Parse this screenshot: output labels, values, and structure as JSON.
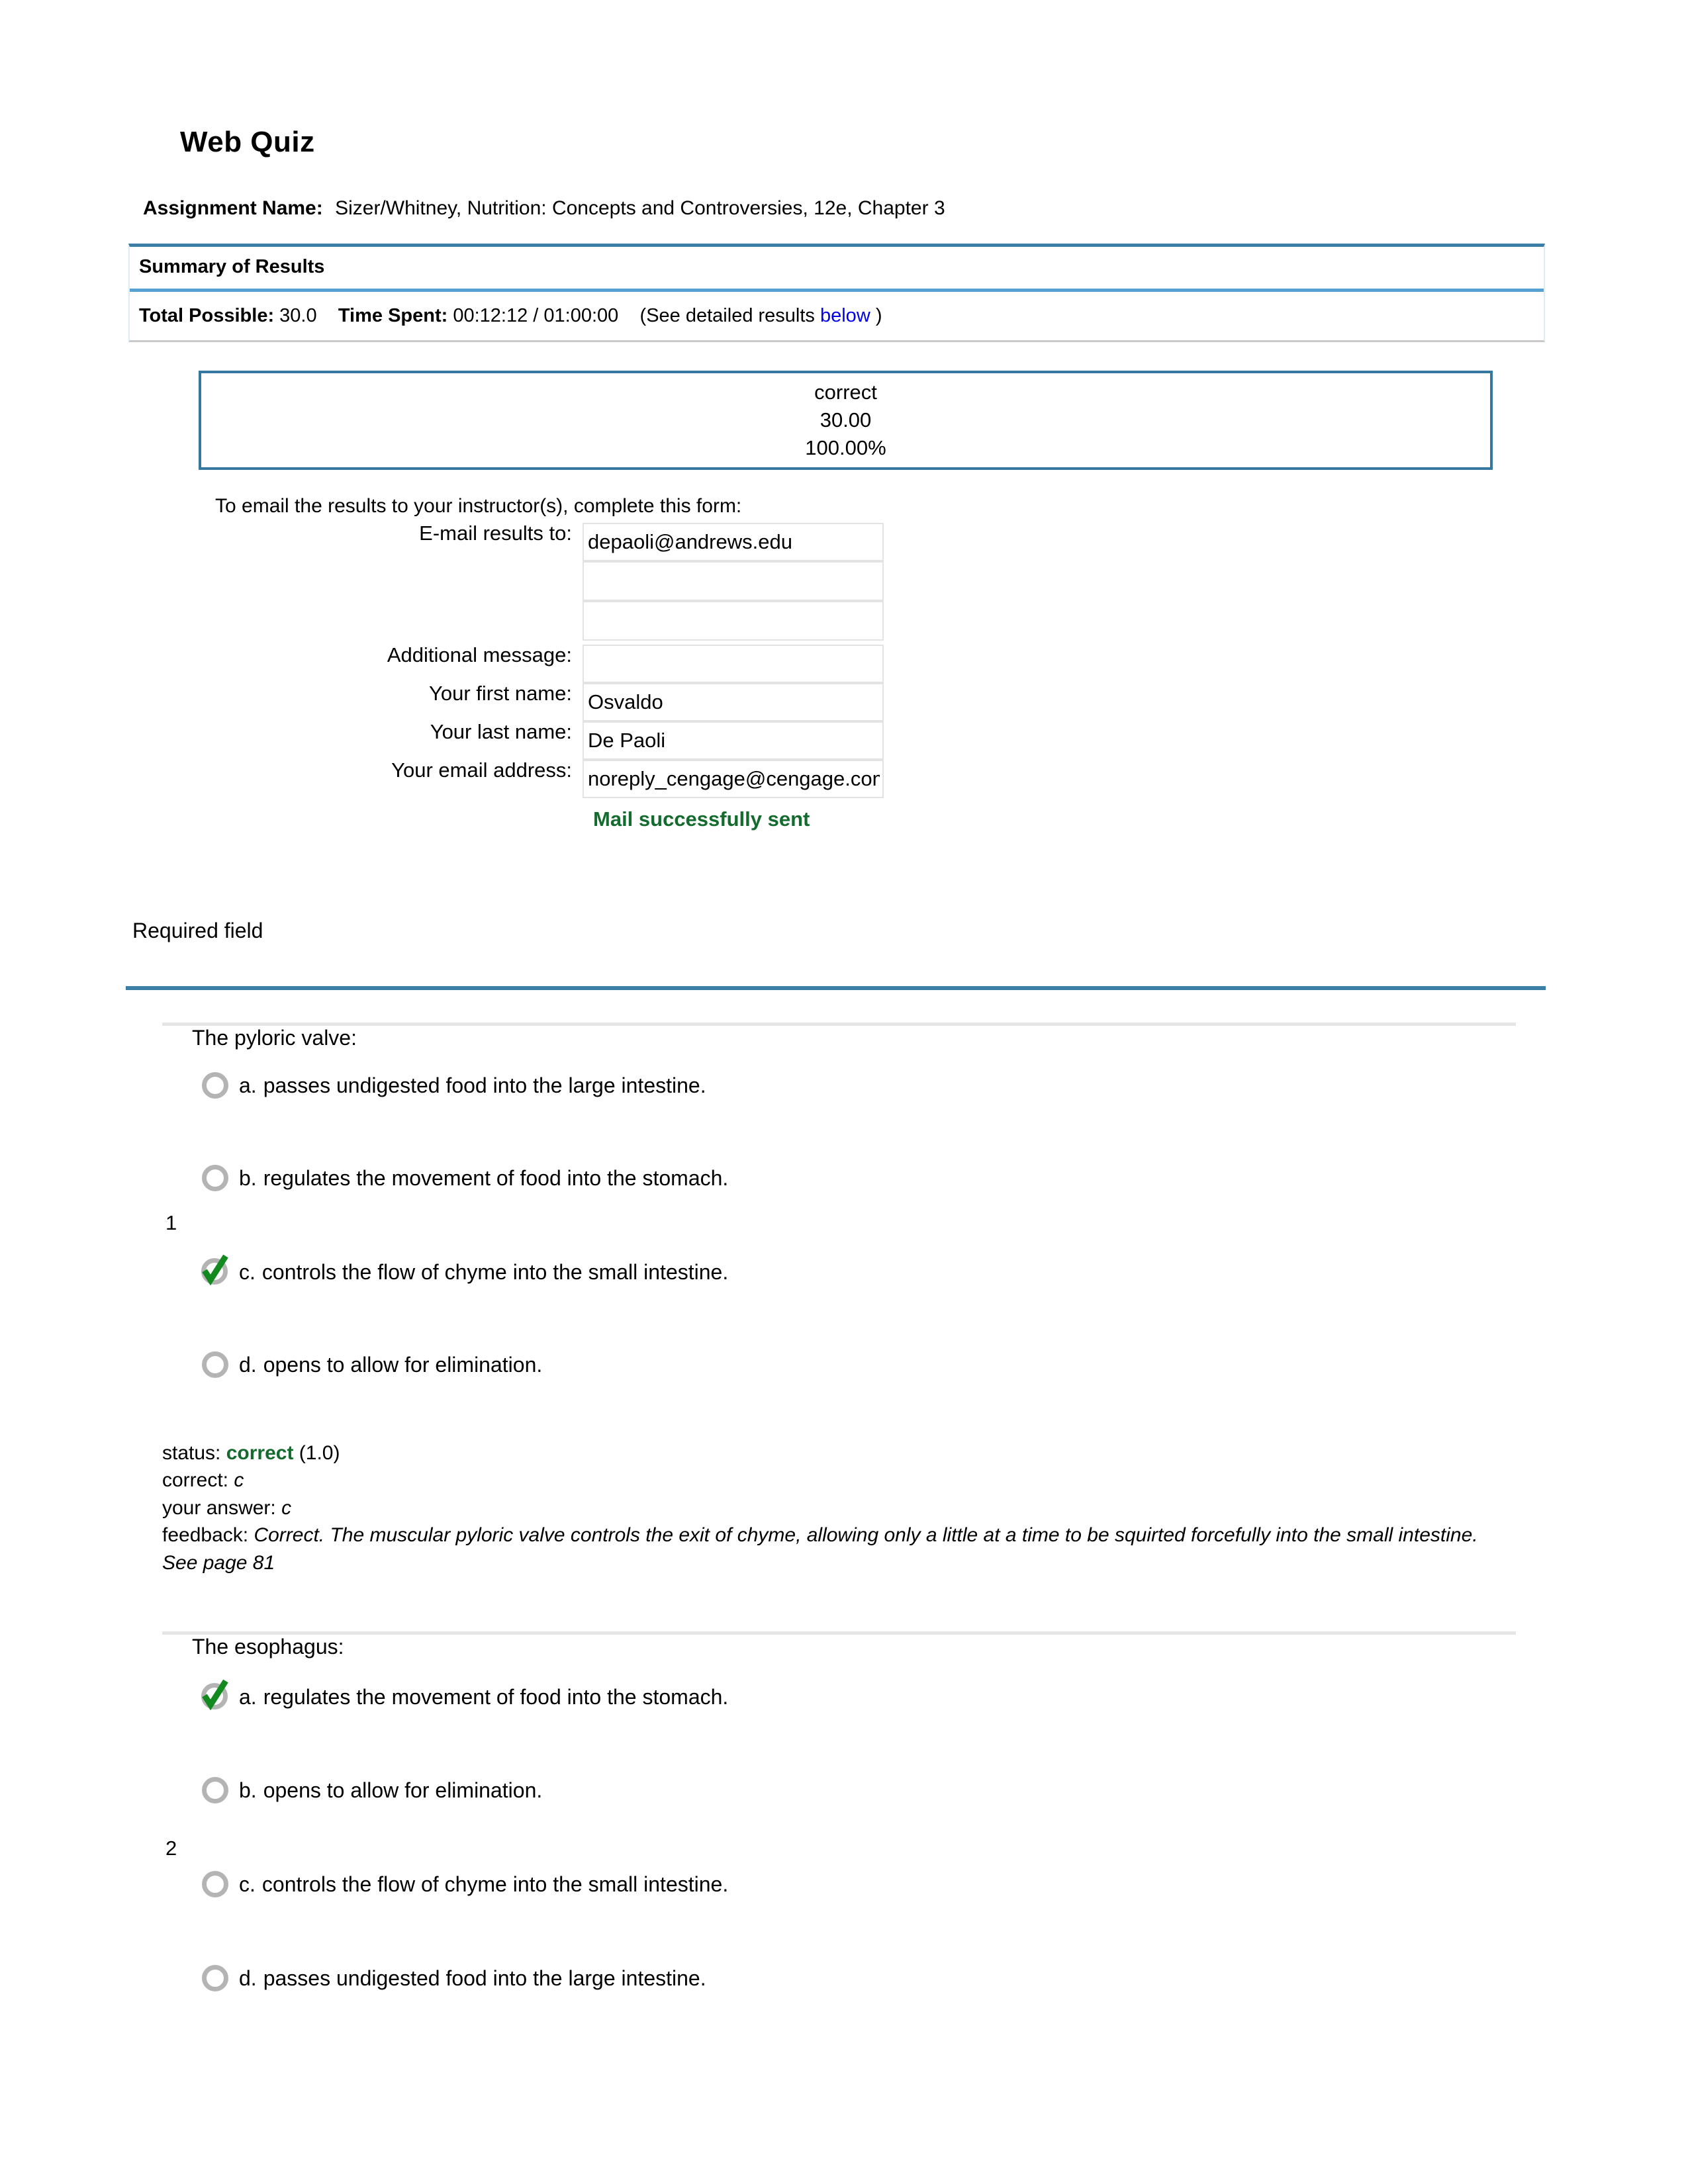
{
  "header": {
    "title": "Web Quiz",
    "assignment_label": "Assignment Name:",
    "assignment_value": "Sizer/Whitney, Nutrition: Concepts and Controversies, 12e, Chapter 3"
  },
  "summary": {
    "heading": "Summary of Results",
    "total_possible_label": "Total Possible:",
    "total_possible_value": "30.0",
    "time_spent_label": "Time Spent:",
    "time_spent_value": "00:12:12 / 01:00:00",
    "detail_prefix": "(See detailed results",
    "detail_link": "below",
    "detail_suffix": ")"
  },
  "score": {
    "status": "correct",
    "points": "30.00",
    "percent": "100.00%"
  },
  "form": {
    "intro": "To email the results to your instructor(s), complete this form:",
    "email_to_label": "E-mail results to:",
    "email_to_value": "depaoli@andrews.edu",
    "email_to_2_value": "",
    "email_to_3_value": "",
    "additional_message_label": "Additional message:",
    "additional_message_value": "",
    "first_name_label": "Your first name:",
    "first_name_value": "Osvaldo",
    "last_name_label": "Your last name:",
    "last_name_value": "De Paoli",
    "email_address_label": "Your email address:",
    "email_address_value": "noreply_cengage@cengage.com",
    "mail_status": "Mail successfully sent"
  },
  "required_field_note": "Required field",
  "questions": [
    {
      "number": "1",
      "stem": "The pyloric valve:",
      "options": [
        {
          "letter": "a.",
          "text": "passes undigested food into the large intestine.",
          "selected": false
        },
        {
          "letter": "b.",
          "text": "regulates the movement of food into the stomach.",
          "selected": false
        },
        {
          "letter": "c.",
          "text": "controls the flow of chyme into the small intestine.",
          "selected": true
        },
        {
          "letter": "d.",
          "text": "opens to allow for elimination.",
          "selected": false
        }
      ],
      "status_label": "status:",
      "status_value": "correct",
      "status_points": "(1.0)",
      "correct_label": "correct:",
      "correct_value": "c",
      "your_answer_label": "your answer:",
      "your_answer_value": "c",
      "feedback_label": "feedback:",
      "feedback_value": "Correct. The muscular pyloric valve controls the exit of chyme, allowing only a little at a time to be squirted forcefully into the small intestine. See page 81"
    },
    {
      "number": "2",
      "stem": "The esophagus:",
      "options": [
        {
          "letter": "a.",
          "text": "regulates the movement of food into the stomach.",
          "selected": true
        },
        {
          "letter": "b.",
          "text": "opens to allow for elimination.",
          "selected": false
        },
        {
          "letter": "c.",
          "text": "controls the flow of chyme into the small intestine.",
          "selected": false
        },
        {
          "letter": "d.",
          "text": "passes undigested food into the large intestine.",
          "selected": false
        }
      ]
    }
  ],
  "colors": {
    "accent_blue": "#3b7ea6",
    "light_blue_border": "#d9ecf7",
    "link_blue": "#0000ee",
    "success_green": "#146b2e",
    "radio_gray": "#b4b4b4",
    "separator_gray": "#e6e6e6"
  }
}
